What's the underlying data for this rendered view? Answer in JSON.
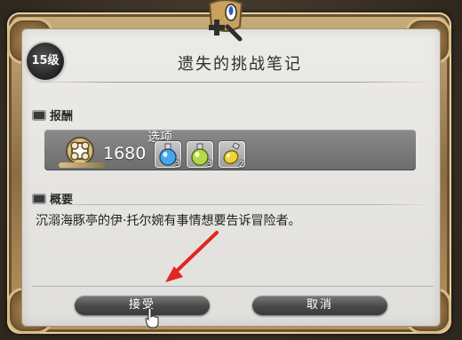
{
  "dialog": {
    "level_badge": "15级",
    "title": "遗失的挑战笔记",
    "reward_heading": "报酬",
    "summary_heading": "概要",
    "summary_text": "沉溺海豚亭的伊·托尔婉有事情想要告诉冒险者。"
  },
  "reward": {
    "gil_icon": "gil-coin-icon",
    "gil_amount": "1680",
    "options_label": "选项",
    "items": [
      {
        "icon": "blue-potion-icon",
        "qty": "3"
      },
      {
        "icon": "green-potion-icon",
        "qty": "3"
      },
      {
        "icon": "yellow-flask-icon",
        "qty": "2"
      }
    ]
  },
  "buttons": {
    "accept_label": "接受",
    "cancel_label": "取消"
  },
  "annotation": {
    "arrow_color": "#e0261f"
  }
}
